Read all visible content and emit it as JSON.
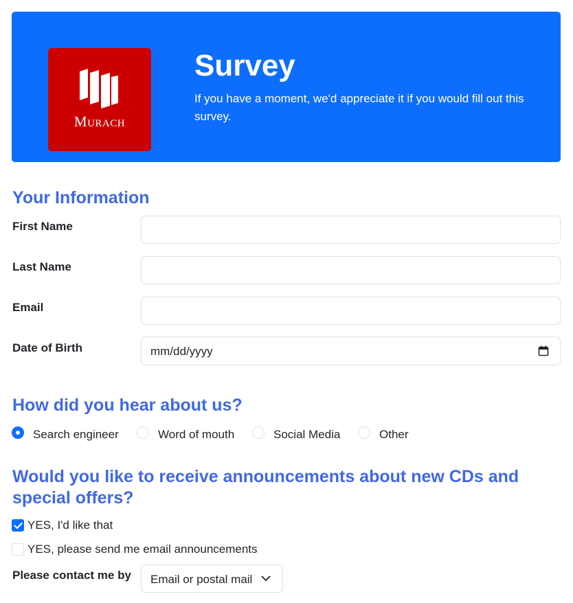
{
  "header": {
    "logo_text": "Murach",
    "title": "Survey",
    "description": "If you have a moment, we'd appreciate it if you would fill out this survey."
  },
  "info_section": {
    "heading": "Your Information",
    "first_name_label": "First Name",
    "first_name_value": "",
    "last_name_label": "Last Name",
    "last_name_value": "",
    "email_label": "Email",
    "email_value": "",
    "dob_label": "Date of Birth",
    "dob_placeholder": "mm/dd/yyyy"
  },
  "hear_section": {
    "heading": "How did you hear about us?",
    "options": [
      {
        "label": "Search engineer",
        "checked": true
      },
      {
        "label": "Word of mouth",
        "checked": false
      },
      {
        "label": "Social Media",
        "checked": false
      },
      {
        "label": "Other",
        "checked": false
      }
    ]
  },
  "announce_section": {
    "heading": "Would you like to receive announcements about new CDs and special offers?",
    "checkbox_yes_label": "YES, I'd like that",
    "checkbox_yes_checked": true,
    "checkbox_email_label": "YES, please send me email announcements",
    "checkbox_email_checked": false,
    "contact_label": "Please contact me by",
    "contact_selected": "Email or postal mail"
  },
  "colors": {
    "header_bg": "#0d6efd",
    "logo_bg": "#cc0000",
    "heading": "#4169e1",
    "accent": "#0d6efd"
  },
  "icons": [
    "murach-logo-icon",
    "calendar-icon",
    "checkmark-icon",
    "chevron-down-icon"
  ]
}
